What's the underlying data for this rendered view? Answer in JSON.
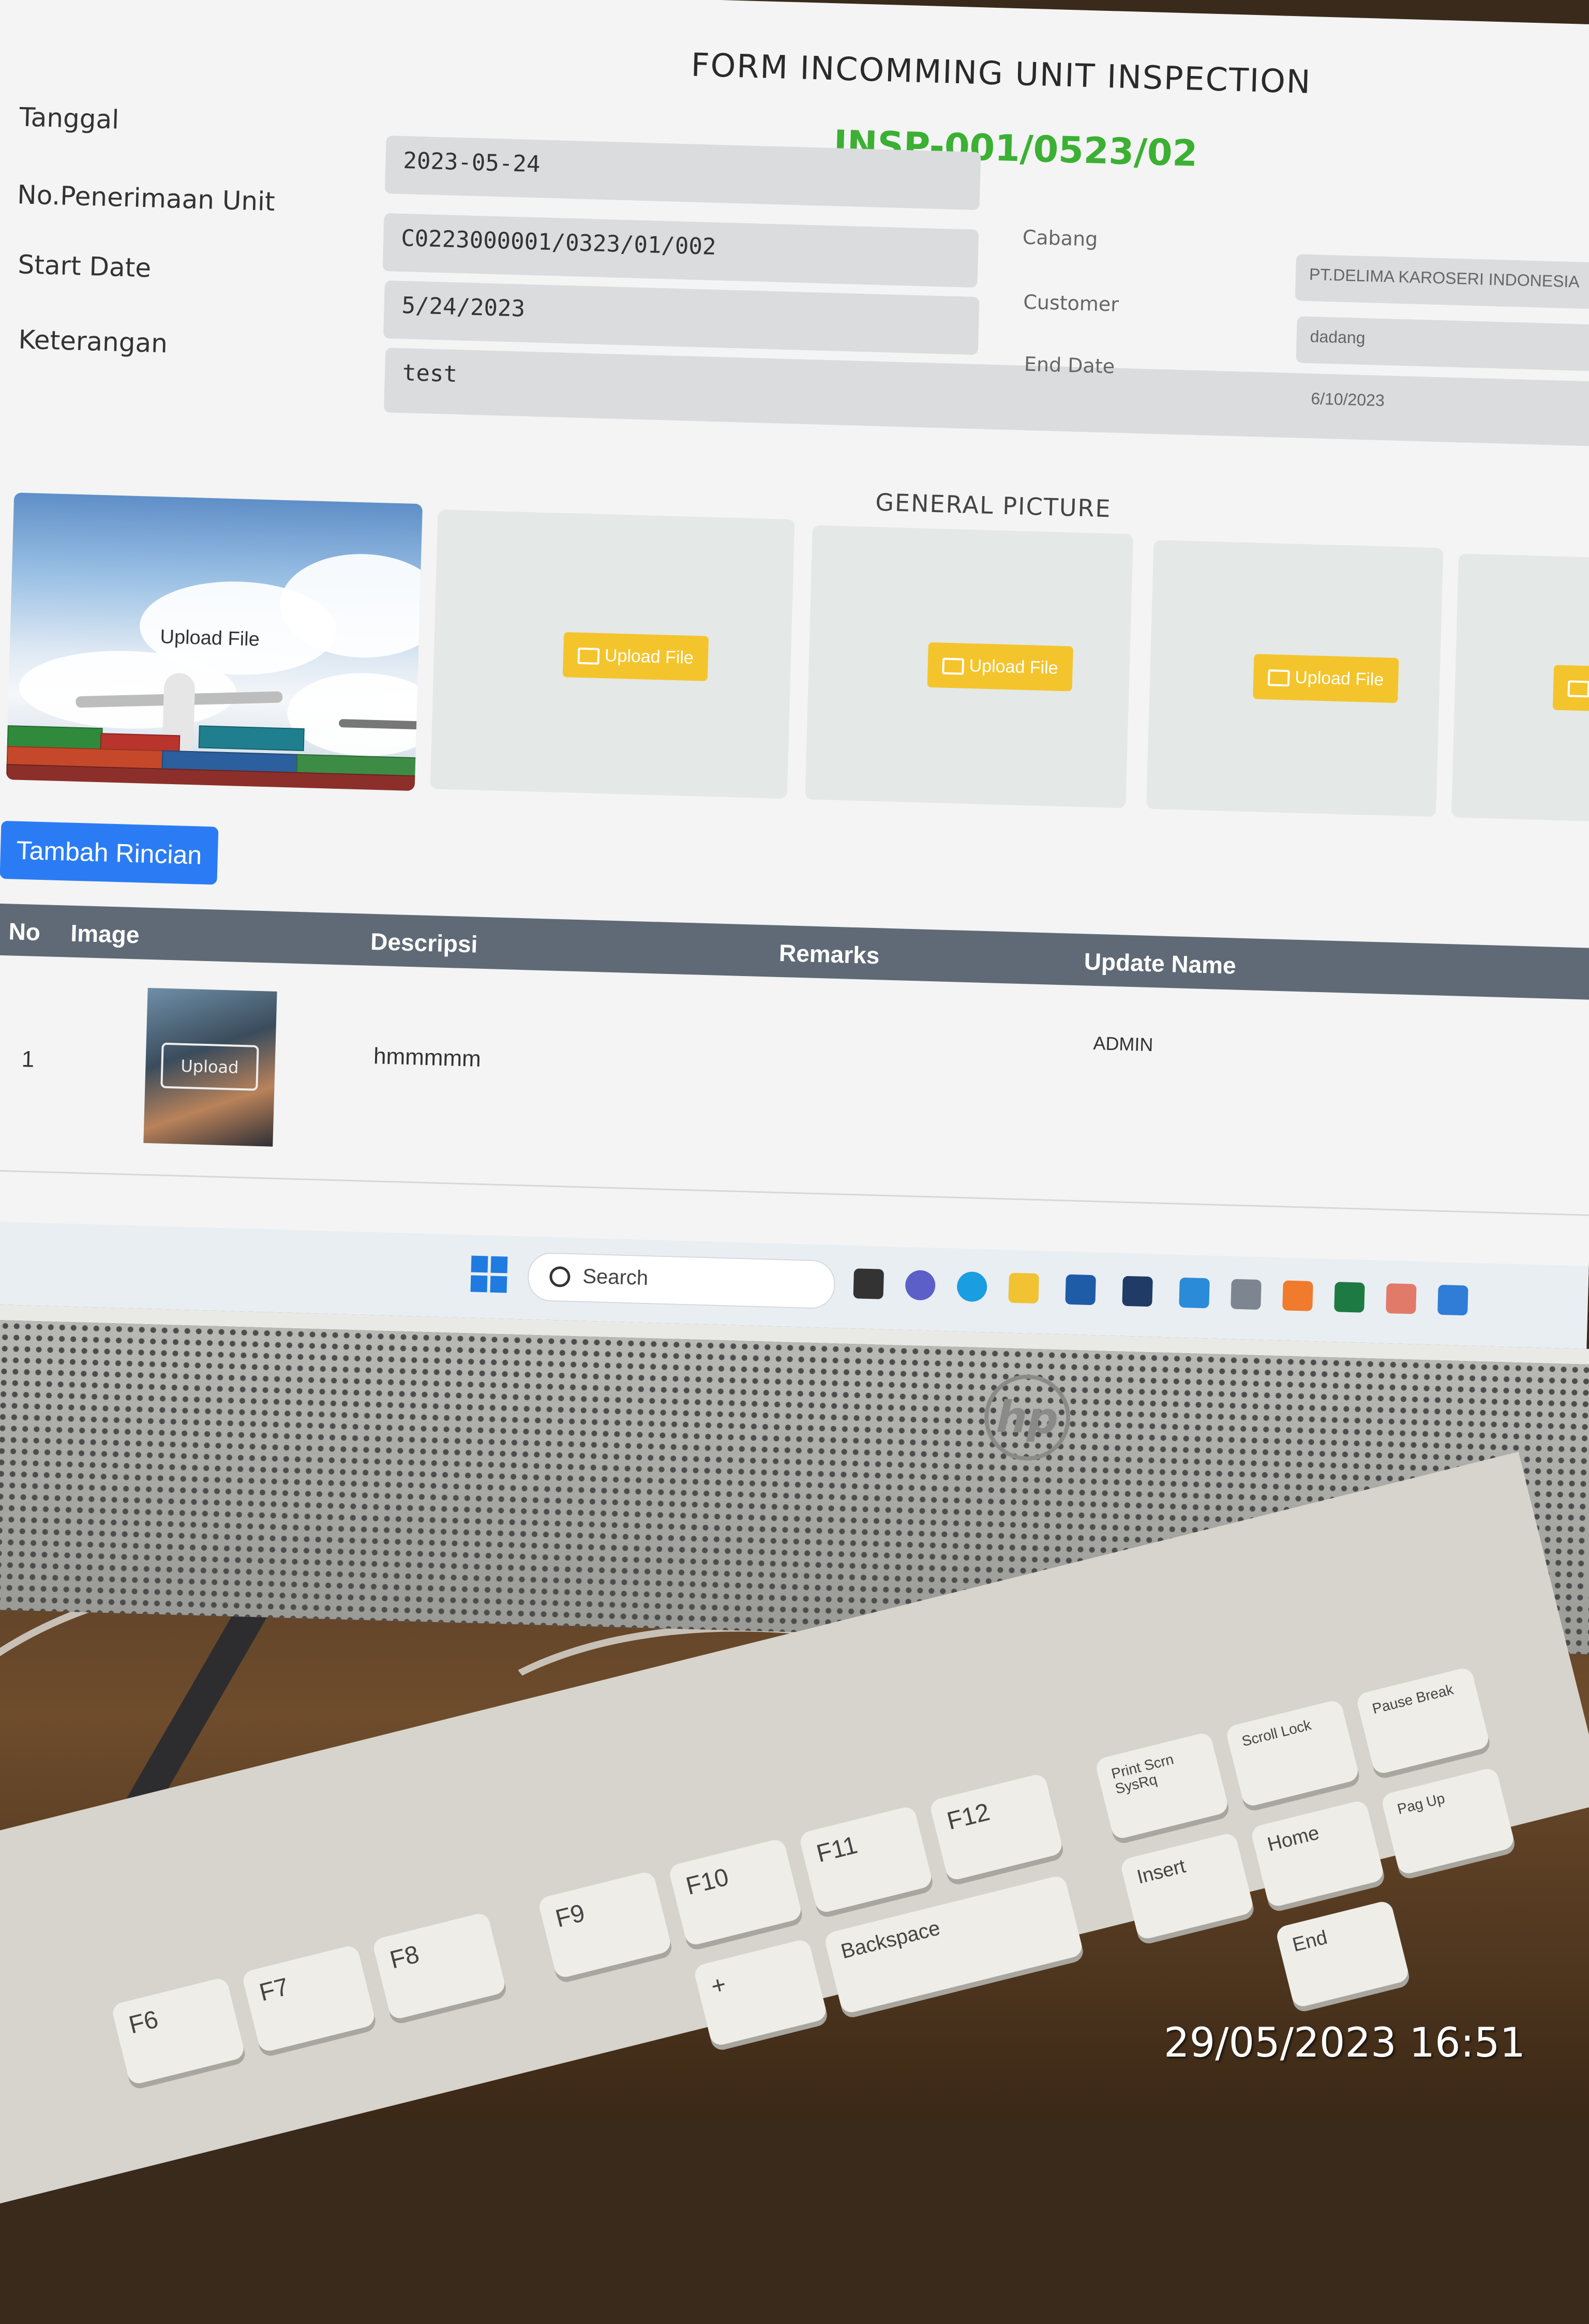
{
  "form": {
    "title": "FORM INCOMMING UNIT INSPECTION",
    "code": "INSP-001/0523/02",
    "fields_left": [
      {
        "label": "Tanggal",
        "value": "2023-05-24"
      },
      {
        "label": "No.Penerimaan Unit",
        "value": "C0223000001/0323/01/002"
      },
      {
        "label": "Start Date",
        "value": "5/24/2023"
      },
      {
        "label": "Keterangan",
        "value": "test"
      }
    ],
    "fields_right": [
      {
        "label": "Cabang",
        "value": "PT.DELIMA KAROSERI INDONESIA"
      },
      {
        "label": "Customer",
        "value": "dadang"
      },
      {
        "label": "End Date",
        "value": "6/10/2023"
      }
    ]
  },
  "general_picture": {
    "title": "GENERAL PICTURE",
    "upload_label": "Upload File"
  },
  "actions": {
    "add_detail": "Tambah Rincian"
  },
  "table": {
    "headers": [
      "No",
      "Image",
      "Descripsi",
      "Remarks",
      "Update Name"
    ],
    "rows": [
      {
        "no": "1",
        "image_button": "Upload",
        "descripsi": "hmmmmm",
        "remarks": "",
        "update_name": "ADMIN"
      }
    ]
  },
  "taskbar": {
    "search_label": "Search"
  },
  "keyboard": {
    "keys": [
      "F6",
      "F7",
      "F8",
      "F9",
      "F10",
      "F11",
      "F12",
      "Print Scrn SysRq",
      "Scroll Lock",
      "Pause Break",
      "Insert",
      "Home",
      "Pag Up",
      "Backspace",
      "End",
      "+"
    ]
  },
  "photo": {
    "timestamp": "29/05/2023 16:51"
  },
  "colors": {
    "code_green": "#3bb033",
    "upload_yellow": "#f4c42c",
    "primary_blue": "#2b7cf4",
    "table_header": "#5f6a76"
  }
}
